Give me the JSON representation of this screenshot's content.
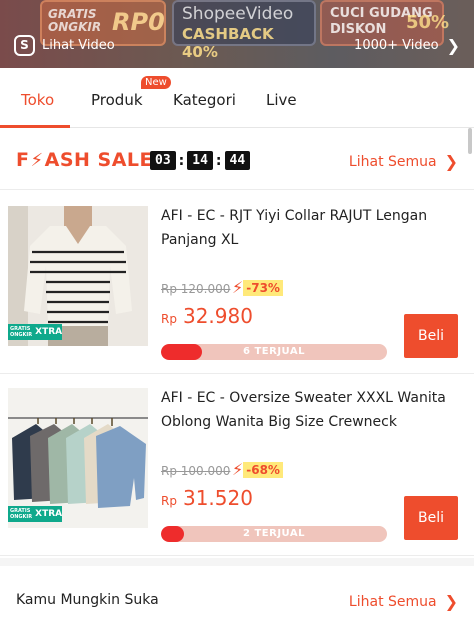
{
  "banner": {
    "promo1_line1": "GRATIS",
    "promo1_line2": "ONGKIR",
    "promo1_big": "RP0",
    "promo2_title": "ShopeeVideo",
    "promo2_sub": "CASHBACK 40%",
    "promo3_line1": "CUCI GUDANG",
    "promo3_line2": "DISKON",
    "promo3_big": "50%",
    "video_icon": "shopee-video-icon",
    "video_link_label": "Lihat Video",
    "video_count_label": "1000+ Video"
  },
  "tabs": [
    {
      "label": "Toko",
      "active": true
    },
    {
      "label": "Produk",
      "badge": "New"
    },
    {
      "label": "Kategori"
    },
    {
      "label": "Live"
    }
  ],
  "flash_sale": {
    "title_part1": "F",
    "title_part2": "ASH SALE",
    "timer": [
      "03",
      "14",
      "44"
    ],
    "see_all": "Lihat Semua"
  },
  "products": [
    {
      "name": "AFI - EC - RJT Yiyi Collar RAJUT Lengan Panjang XL",
      "old_price": "Rp 120.000",
      "discount": "-73%",
      "currency": "Rp",
      "price": "32.980",
      "sold_label": "6 TERJUAL",
      "sold_fraction": 0.18,
      "buy_label": "Beli",
      "badge_small": "GRATIS ONGKIR",
      "badge_big": "XTRA"
    },
    {
      "name": "AFI - EC - Oversize Sweater  XXXL Wanita Oblong Wanita Big Size Crewneck",
      "old_price": "Rp 100.000",
      "discount": "-68%",
      "currency": "Rp",
      "price": "31.520",
      "sold_label": "2 TERJUAL",
      "sold_fraction": 0.1,
      "buy_label": "Beli",
      "badge_small": "GRATIS ONGKIR",
      "badge_big": "XTRA"
    }
  ],
  "recommendation": {
    "title": "Kamu Mungkin Suka",
    "see_all": "Lihat Semua"
  },
  "colors": {
    "accent": "#ee4d2d",
    "xtra_badge": "#0fa98c",
    "discount_bg": "#ffe97a"
  }
}
